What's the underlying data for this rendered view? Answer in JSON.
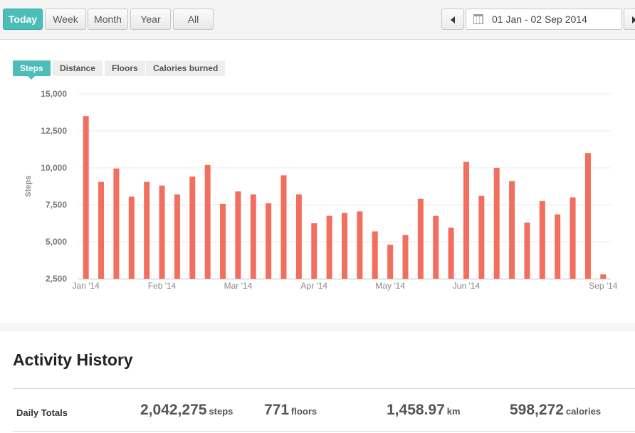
{
  "range_buttons": [
    {
      "label": "Today",
      "active": true
    },
    {
      "label": "Week",
      "active": false
    },
    {
      "label": "Month",
      "active": false
    },
    {
      "label": "Year",
      "active": false
    },
    {
      "label": "All",
      "active": false
    }
  ],
  "date_range": "01 Jan - 02 Sep 2014",
  "metric_tabs": [
    {
      "label": "Steps",
      "active": true
    },
    {
      "label": "Distance",
      "active": false
    },
    {
      "label": "Floors",
      "active": false
    },
    {
      "label": "Calories burned",
      "active": false
    }
  ],
  "chart_data": {
    "type": "bar",
    "ylabel": "Steps",
    "xlabel": "",
    "title": "",
    "ylim": [
      2500,
      15000
    ],
    "yticks": [
      "2,500",
      "5,000",
      "7,500",
      "10,000",
      "12,500",
      "15,000"
    ],
    "ytick_values": [
      2500,
      5000,
      7500,
      10000,
      12500,
      15000
    ],
    "x_labels": [
      {
        "label": "Jan '14",
        "bar_index": 0
      },
      {
        "label": "Feb '14",
        "bar_index": 5
      },
      {
        "label": "Mar '14",
        "bar_index": 10
      },
      {
        "label": "Apr '14",
        "bar_index": 15
      },
      {
        "label": "May '14",
        "bar_index": 20
      },
      {
        "label": "Jun '14",
        "bar_index": 25
      },
      {
        "label": "Sep '14",
        "bar_index": 34
      }
    ],
    "values": [
      13500,
      9050,
      9950,
      8050,
      9050,
      8800,
      8200,
      9400,
      10200,
      7550,
      8400,
      8200,
      7600,
      9500,
      8200,
      6250,
      6750,
      6950,
      7050,
      5700,
      4800,
      5450,
      7900,
      6750,
      5950,
      10400,
      8100,
      10000,
      9100,
      6300,
      7750,
      6850,
      8000,
      11000,
      2800
    ],
    "bar_color": "#f26e5f",
    "grid": true
  },
  "history": {
    "title": "Activity History",
    "totals_label": "Daily Totals",
    "stats": [
      {
        "value": "2,042,275",
        "unit": "steps"
      },
      {
        "value": "771",
        "unit": "floors"
      },
      {
        "value": "1,458.97",
        "unit": "km"
      },
      {
        "value": "598,272",
        "unit": "calories"
      }
    ]
  },
  "colors": {
    "accent": "#4cbdb8",
    "bar": "#f26e5f"
  }
}
